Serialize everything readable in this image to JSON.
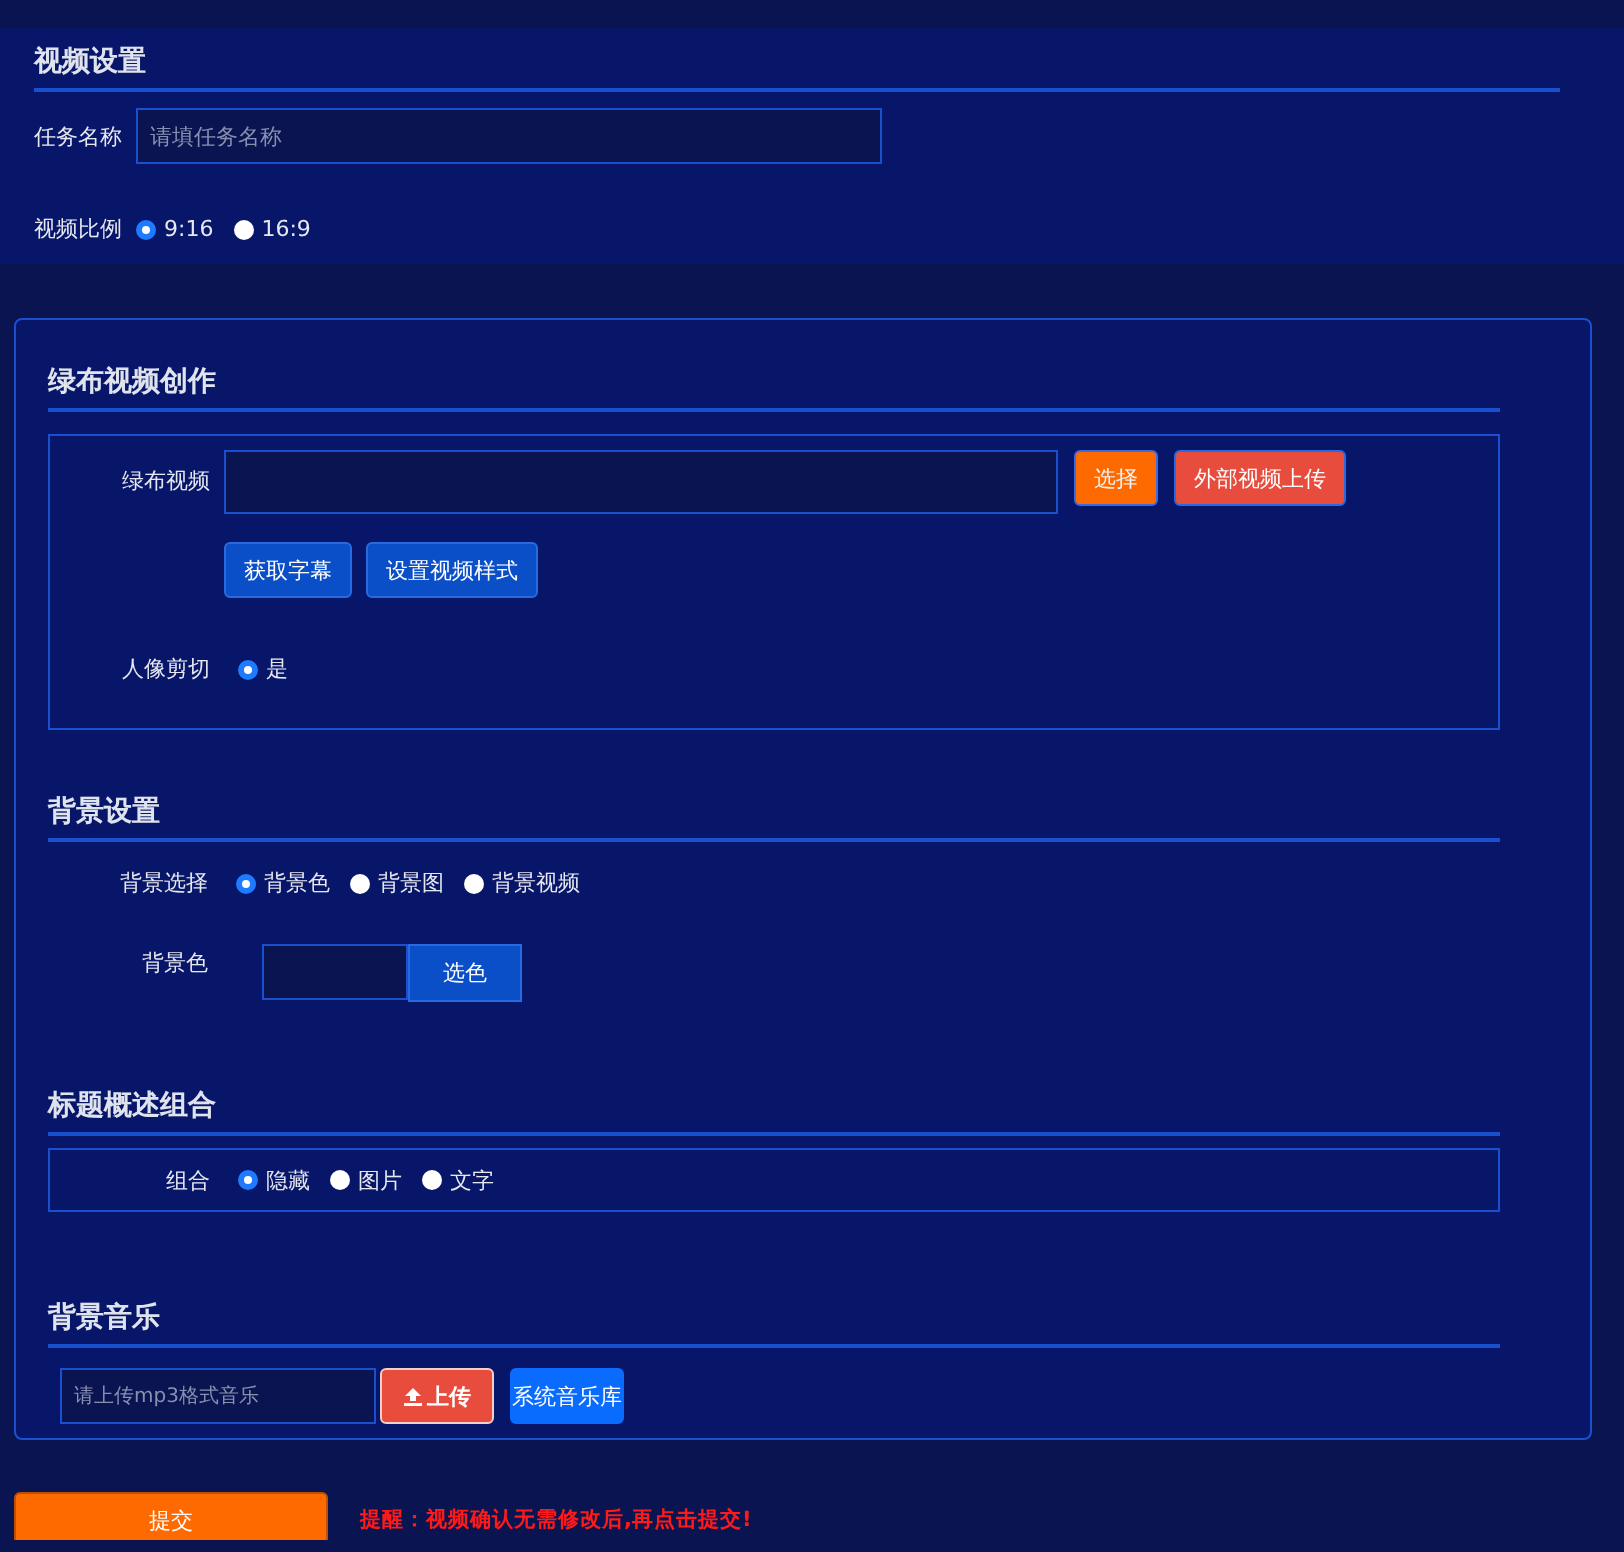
{
  "video_settings": {
    "title": "视频设置",
    "task_name": {
      "label": "任务名称",
      "placeholder": "请填任务名称"
    },
    "ratio": {
      "label": "视频比例",
      "options": [
        {
          "label": "9:16",
          "selected": true
        },
        {
          "label": "16:9",
          "selected": false
        }
      ]
    }
  },
  "green_screen": {
    "title": "绿布视频创作",
    "video": {
      "label": "绿布视频",
      "buttons": [
        {
          "label": "选择",
          "kind": "warning"
        },
        {
          "label": "外部视频上传",
          "kind": "danger"
        }
      ]
    },
    "actions": [
      {
        "label": "获取字幕",
        "kind": "primary"
      },
      {
        "label": "设置视频样式",
        "kind": "primary"
      }
    ],
    "portrait_cut": {
      "label": "人像剪切",
      "options": [
        {
          "label": "是",
          "selected": true
        }
      ]
    }
  },
  "background": {
    "title": "背景设置",
    "choice": {
      "label": "背景选择",
      "options": [
        {
          "label": "背景色",
          "selected": true
        },
        {
          "label": "背景图",
          "selected": false
        },
        {
          "label": "背景视频",
          "selected": false
        }
      ]
    },
    "color": {
      "label": "背景色",
      "button": "选色"
    }
  },
  "title_group": {
    "title": "标题概述组合",
    "combo": {
      "label": "组合",
      "options": [
        {
          "label": "隐藏",
          "selected": true
        },
        {
          "label": "图片",
          "selected": false
        },
        {
          "label": "文字",
          "selected": false
        }
      ]
    }
  },
  "music": {
    "title": "背景音乐",
    "placeholder": "请上传mp3格式音乐",
    "upload": "上传",
    "library": "系统音乐库"
  },
  "submit": "提交",
  "notice": "提醒：视频确认无需修改后,再点击提交!"
}
